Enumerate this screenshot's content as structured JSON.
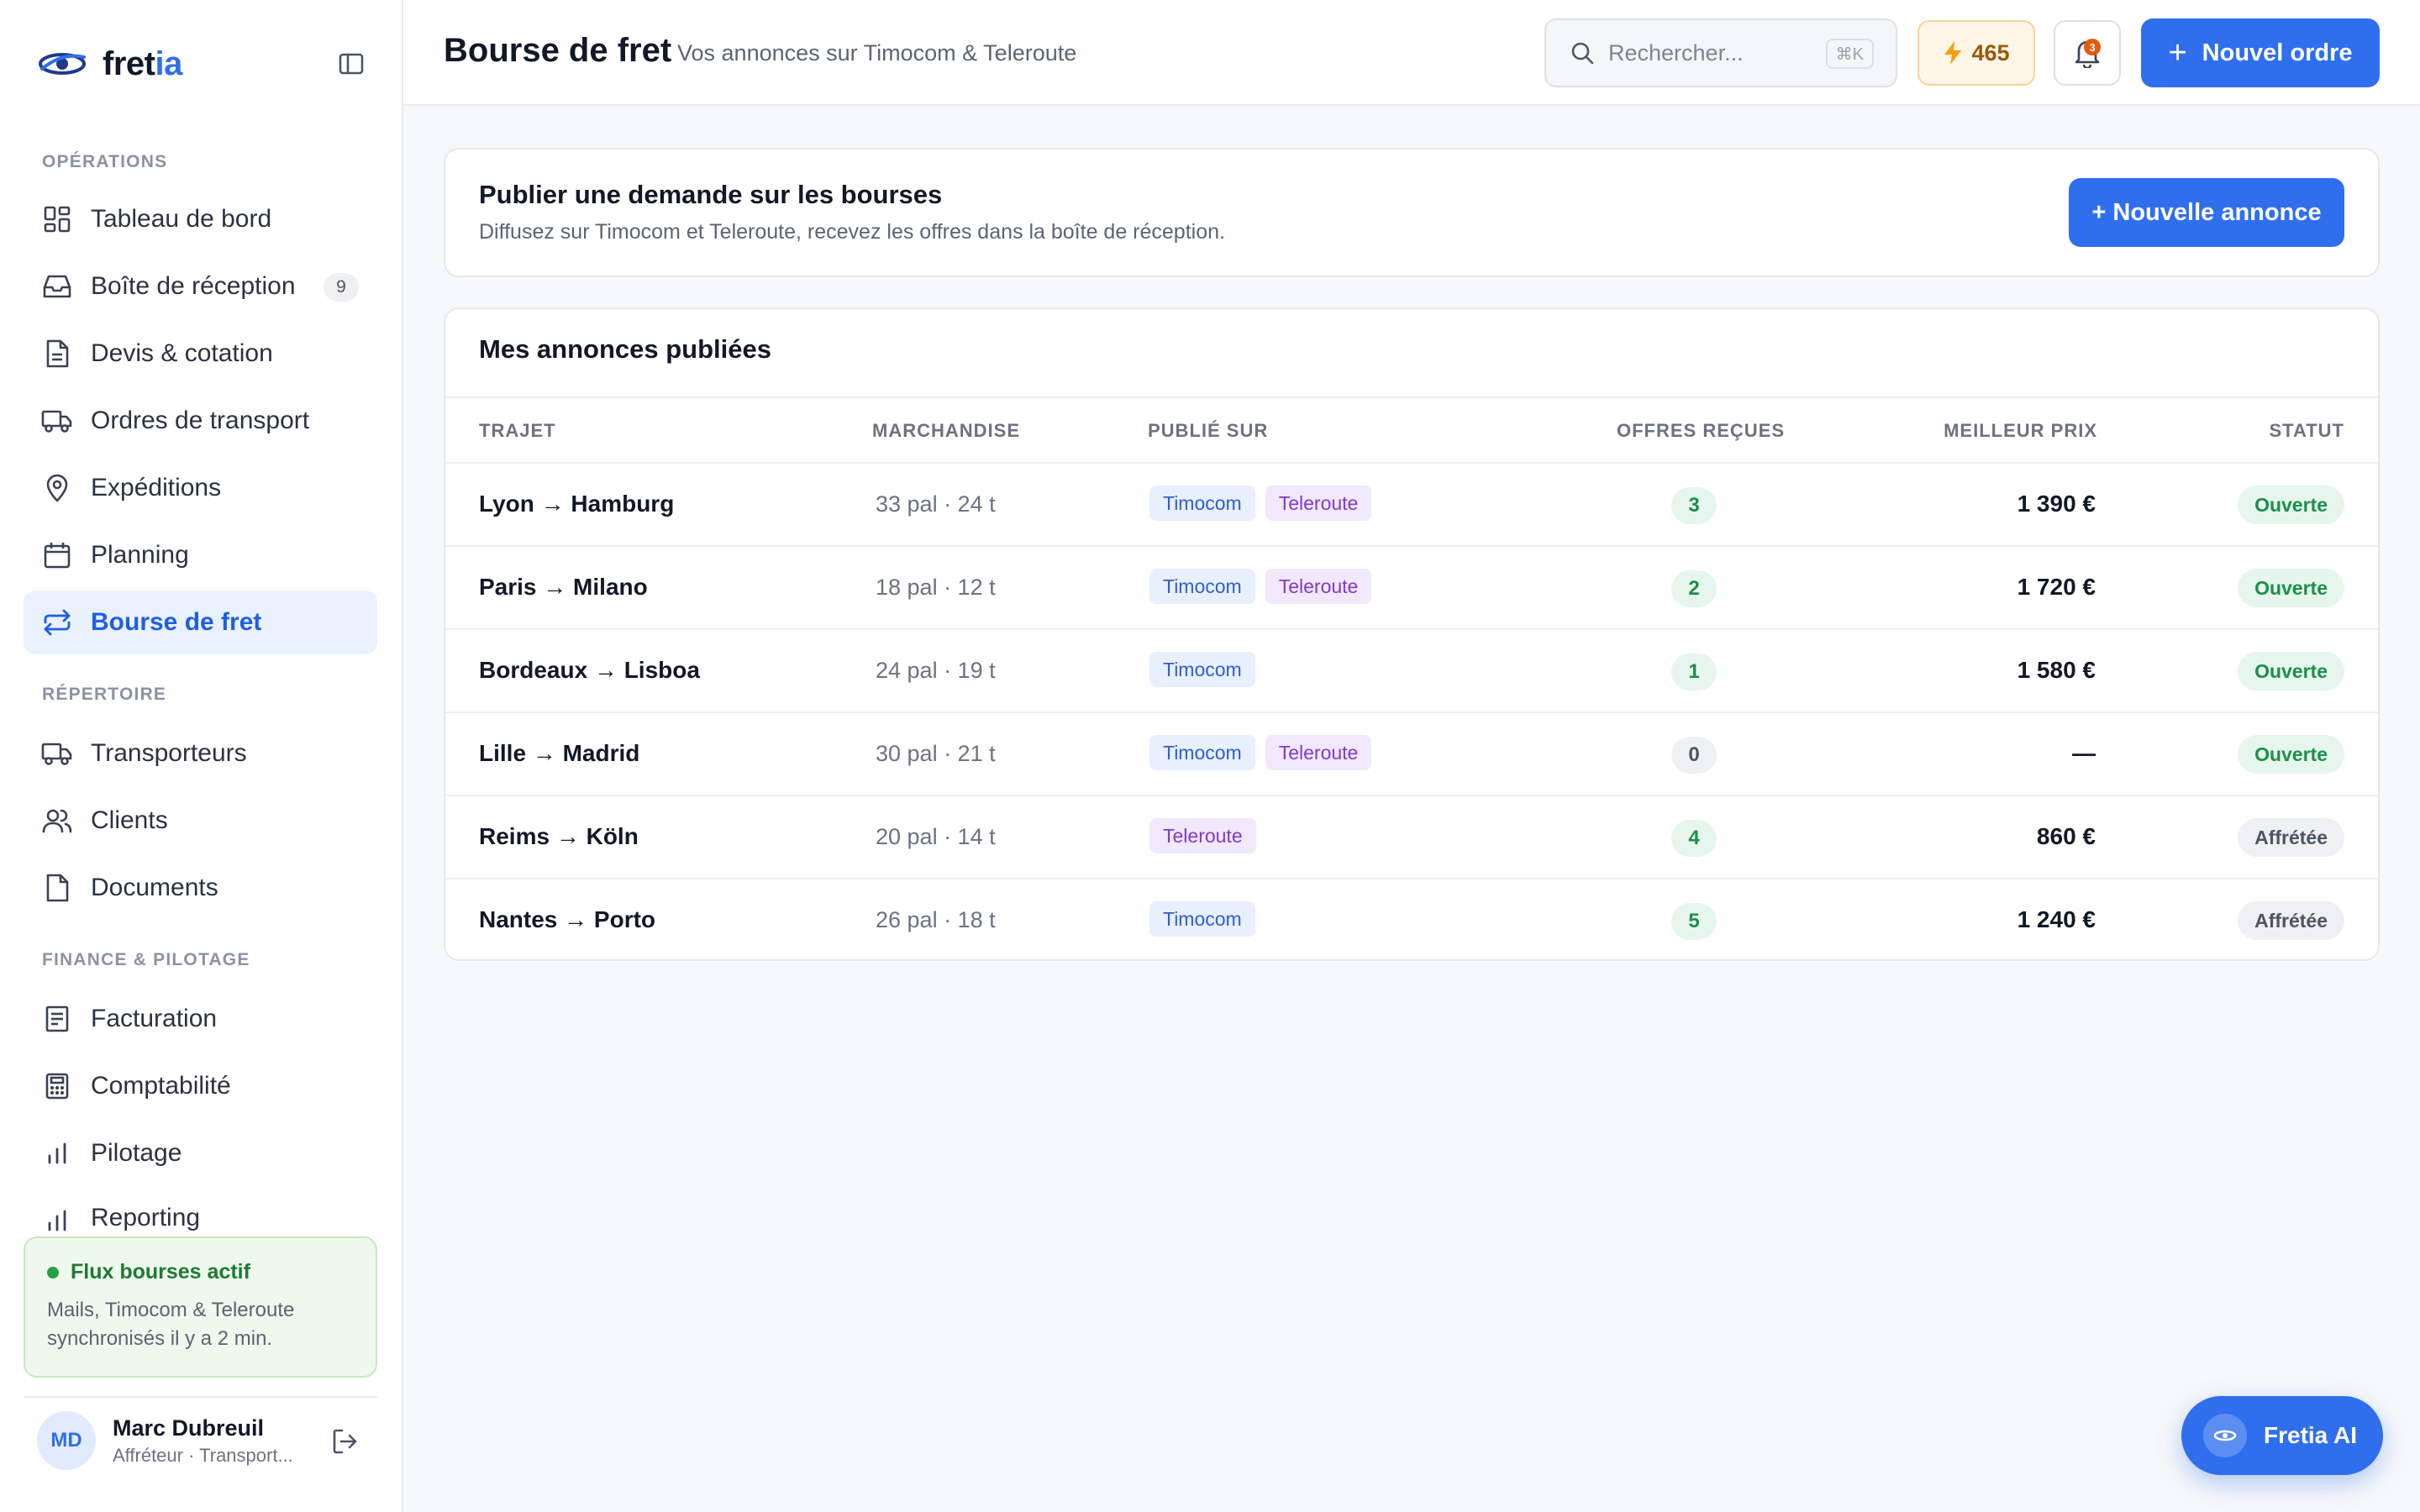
{
  "brand": {
    "name_part1": "fret",
    "name_part2": "ia",
    "primary_color": "#2f6fed"
  },
  "sidebar": {
    "sections": [
      {
        "label": "OPÉRATIONS"
      },
      {
        "label": "RÉPERTOIRE"
      },
      {
        "label": "FINANCE & PILOTAGE"
      }
    ],
    "items": [
      {
        "label": "Tableau de bord",
        "icon": "dashboard-icon"
      },
      {
        "label": "Boîte de réception",
        "icon": "inbox-icon",
        "badge": "9"
      },
      {
        "label": "Devis & cotation",
        "icon": "document-icon"
      },
      {
        "label": "Ordres de transport",
        "icon": "truck-icon"
      },
      {
        "label": "Expéditions",
        "icon": "map-pin-icon"
      },
      {
        "label": "Planning",
        "icon": "calendar-icon"
      },
      {
        "label": "Bourse de fret",
        "icon": "exchange-icon",
        "active": true
      },
      {
        "label": "Transporteurs",
        "icon": "truck-icon"
      },
      {
        "label": "Clients",
        "icon": "users-icon"
      },
      {
        "label": "Documents",
        "icon": "file-icon"
      },
      {
        "label": "Facturation",
        "icon": "invoice-icon"
      },
      {
        "label": "Comptabilité",
        "icon": "calculator-icon"
      },
      {
        "label": "Pilotage",
        "icon": "bar-chart-icon"
      },
      {
        "label": "Reporting",
        "icon": "bar-chart-icon"
      }
    ],
    "flux": {
      "title": "Flux bourses actif",
      "text_line1": "Mails, Timocom & Teleroute",
      "text_line2": "synchronisés il y a 2 min."
    },
    "user": {
      "initials": "MD",
      "name": "Marc Dubreuil",
      "role": "Affréteur · Transport..."
    }
  },
  "topbar": {
    "title": "Bourse de fret",
    "subtitle": "Vos annonces sur Timocom & Teleroute",
    "search_placeholder": "Rechercher...",
    "search_shortcut": "⌘K",
    "credits": "465",
    "notifications_count": "3",
    "new_order_label": "Nouvel ordre",
    "new_order_plus": "+"
  },
  "publish": {
    "title": "Publier une demande sur les bourses",
    "subtitle": "Diffusez sur Timocom et Teleroute, recevez les offres dans la boîte de réception.",
    "button_label": "+ Nouvelle annonce"
  },
  "listings": {
    "title": "Mes annonces publiées",
    "columns": {
      "route": "TRAJET",
      "goods": "MARCHANDISE",
      "published_on": "PUBLIÉ SUR",
      "offers": "OFFRES REÇUES",
      "best_price": "MEILLEUR PRIX",
      "status": "STATUT"
    },
    "rows": [
      {
        "route": "Lyon → Hamburg",
        "goods": "33 pal · 24 t",
        "tags": [
          "Timocom",
          "Teleroute"
        ],
        "offers": "3",
        "price": "1 390 €",
        "status": "Ouverte"
      },
      {
        "route": "Paris → Milano",
        "goods": "18 pal · 12 t",
        "tags": [
          "Timocom",
          "Teleroute"
        ],
        "offers": "2",
        "price": "1 720 €",
        "status": "Ouverte"
      },
      {
        "route": "Bordeaux → Lisboa",
        "goods": "24 pal · 19 t",
        "tags": [
          "Timocom"
        ],
        "offers": "1",
        "price": "1 580 €",
        "status": "Ouverte"
      },
      {
        "route": "Lille → Madrid",
        "goods": "30 pal · 21 t",
        "tags": [
          "Timocom",
          "Teleroute"
        ],
        "offers": "0",
        "price": "—",
        "status": "Ouverte"
      },
      {
        "route": "Reims → Köln",
        "goods": "20 pal · 14 t",
        "tags": [
          "Teleroute"
        ],
        "offers": "4",
        "price": "860 €",
        "status": "Affrétée"
      },
      {
        "route": "Nantes → Porto",
        "goods": "26 pal · 18 t",
        "tags": [
          "Timocom"
        ],
        "offers": "5",
        "price": "1 240 €",
        "status": "Affrétée"
      }
    ]
  },
  "ai_button": {
    "label": "Fretia AI"
  }
}
